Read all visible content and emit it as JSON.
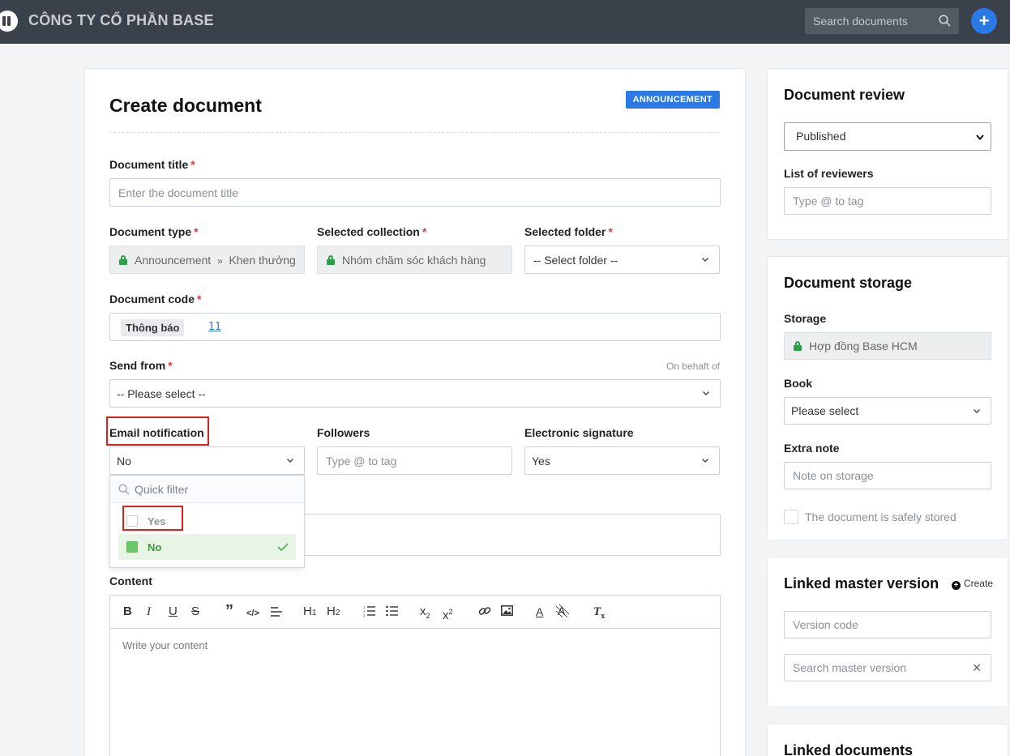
{
  "topbar": {
    "brand": "CÔNG TY CỔ PHẦN BASE",
    "search_placeholder": "Search documents",
    "add_label": "+"
  },
  "form": {
    "title": "Create document",
    "badge": "ANNOUNCEMENT",
    "doc_title_label": "Document title",
    "doc_title_placeholder": "Enter the document title",
    "doc_type_label": "Document type",
    "doc_type_value": "Announcement",
    "doc_type_sep": "»",
    "doc_type_sub": "Khen thưởng",
    "collection_label": "Selected collection",
    "collection_value": "Nhóm chăm sóc khách hàng",
    "folder_label": "Selected folder",
    "folder_value": "-- Select folder --",
    "code_label": "Document code",
    "code_tag": "Thông báo",
    "code_number": "11",
    "send_from_label": "Send from",
    "send_from_hint": "On behaft of",
    "send_from_value": "-- Please select --",
    "email_label": "Email notification",
    "email_value": "No",
    "followers_label": "Followers",
    "followers_placeholder": "Type @ to tag",
    "esign_label": "Electronic signature",
    "esign_value": "Yes",
    "dropdown": {
      "filter_placeholder": "Quick filter",
      "options": [
        "Yes",
        "No"
      ]
    },
    "content_label": "Content",
    "content_placeholder": "Write your content",
    "toolbar": {
      "bold": "B",
      "italic": "I",
      "underline": "U",
      "strike": "S",
      "quote": "”",
      "code": "</>",
      "h1": "H",
      "h1_sub": "1",
      "h2": "H",
      "h2_sub": "2",
      "sub": "x",
      "sub_mark": "2",
      "sup": "x",
      "sup_mark": "2",
      "color": "A",
      "clear": "T",
      "clear_mark": "x"
    }
  },
  "review": {
    "title": "Document review",
    "status_value": "Published",
    "reviewers_label": "List of reviewers",
    "reviewers_placeholder": "Type @ to tag"
  },
  "storage": {
    "title": "Document storage",
    "storage_label": "Storage",
    "storage_value": "Hợp đồng Base HCM",
    "book_label": "Book",
    "book_value": "Please select",
    "note_label": "Extra note",
    "note_placeholder": "Note on storage",
    "safe_label": "The document is safely stored"
  },
  "master": {
    "title": "Linked master version",
    "create_label": "Create",
    "create_icon": "+",
    "version_placeholder": "Version code",
    "search_placeholder": "Search master version",
    "clear_icon": "✕"
  },
  "linked": {
    "title": "Linked documents"
  }
}
